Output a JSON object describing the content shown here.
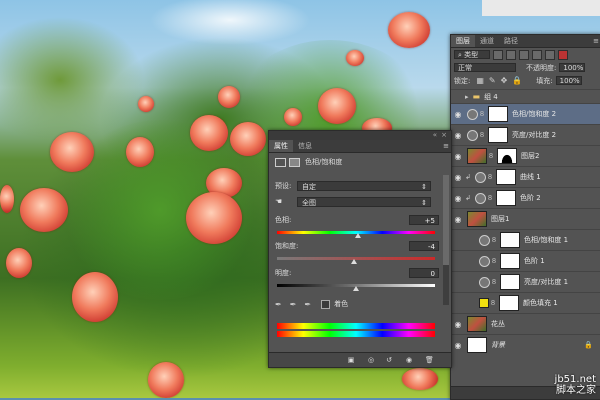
{
  "layers_panel": {
    "tabs": [
      "图层",
      "通道",
      "路径"
    ],
    "filter_select": "类型",
    "blend_mode": "正常",
    "opacity_label": "不透明度:",
    "opacity_value": "100%",
    "lock_label": "锁定:",
    "fill_label": "填充:",
    "fill_value": "100%",
    "layers": [
      {
        "name": "组 4",
        "kind": "group",
        "visible": false
      },
      {
        "name": "色相/饱和度 2",
        "kind": "adjustment",
        "visible": true,
        "selected": true
      },
      {
        "name": "亮度/对比度 2",
        "kind": "adjustment",
        "visible": true
      },
      {
        "name": "图层2",
        "kind": "pixel-mask",
        "visible": true
      },
      {
        "name": "曲线 1",
        "kind": "adjustment",
        "visible": true
      },
      {
        "name": "色阶 2",
        "kind": "adjustment",
        "visible": true
      },
      {
        "name": "图层1",
        "kind": "pixel",
        "visible": true
      },
      {
        "name": "色相/饱和度 1",
        "kind": "adjustment",
        "visible": false
      },
      {
        "name": "色阶 1",
        "kind": "adjustment",
        "visible": false
      },
      {
        "name": "亮度/对比度 1",
        "kind": "adjustment",
        "visible": false
      },
      {
        "name": "颜色填充 1",
        "kind": "fill",
        "visible": false
      },
      {
        "name": "花丛",
        "kind": "pixel",
        "visible": true
      },
      {
        "name": "背景",
        "kind": "background",
        "visible": true
      }
    ]
  },
  "properties_panel": {
    "tabs": [
      "属性",
      "信息"
    ],
    "title": "色相/饱和度",
    "preset_label": "预设:",
    "preset_value": "自定",
    "channel_value": "全图",
    "hue_label": "色相:",
    "hue_value": "+5",
    "hue_fraction": 0.51,
    "saturation_label": "饱和度:",
    "saturation_value": "-4",
    "saturation_fraction": 0.49,
    "lightness_label": "明度:",
    "lightness_value": "0",
    "lightness_fraction": 0.5,
    "colorize_label": "着色"
  },
  "watermark": {
    "line1": "jb51.net",
    "line2": "脚本之家"
  },
  "colors": {
    "panel_bg": "#535353",
    "selected_row": "#5d6d86"
  }
}
